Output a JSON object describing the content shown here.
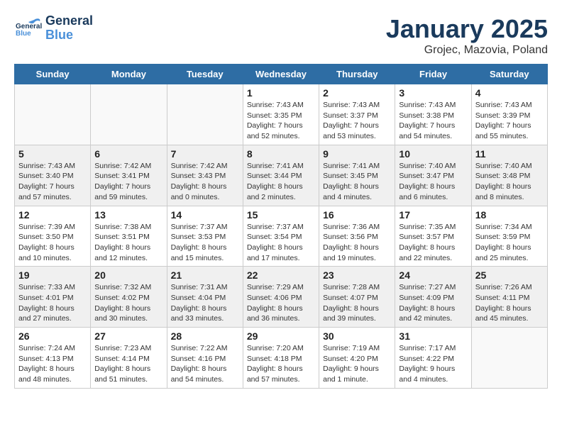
{
  "logo": {
    "line1": "General",
    "line2": "Blue"
  },
  "title": "January 2025",
  "location": "Grojec, Mazovia, Poland",
  "days_of_week": [
    "Sunday",
    "Monday",
    "Tuesday",
    "Wednesday",
    "Thursday",
    "Friday",
    "Saturday"
  ],
  "weeks": [
    [
      {
        "day": "",
        "info": ""
      },
      {
        "day": "",
        "info": ""
      },
      {
        "day": "",
        "info": ""
      },
      {
        "day": "1",
        "info": "Sunrise: 7:43 AM\nSunset: 3:35 PM\nDaylight: 7 hours\nand 52 minutes."
      },
      {
        "day": "2",
        "info": "Sunrise: 7:43 AM\nSunset: 3:37 PM\nDaylight: 7 hours\nand 53 minutes."
      },
      {
        "day": "3",
        "info": "Sunrise: 7:43 AM\nSunset: 3:38 PM\nDaylight: 7 hours\nand 54 minutes."
      },
      {
        "day": "4",
        "info": "Sunrise: 7:43 AM\nSunset: 3:39 PM\nDaylight: 7 hours\nand 55 minutes."
      }
    ],
    [
      {
        "day": "5",
        "info": "Sunrise: 7:43 AM\nSunset: 3:40 PM\nDaylight: 7 hours\nand 57 minutes."
      },
      {
        "day": "6",
        "info": "Sunrise: 7:42 AM\nSunset: 3:41 PM\nDaylight: 7 hours\nand 59 minutes."
      },
      {
        "day": "7",
        "info": "Sunrise: 7:42 AM\nSunset: 3:43 PM\nDaylight: 8 hours\nand 0 minutes."
      },
      {
        "day": "8",
        "info": "Sunrise: 7:41 AM\nSunset: 3:44 PM\nDaylight: 8 hours\nand 2 minutes."
      },
      {
        "day": "9",
        "info": "Sunrise: 7:41 AM\nSunset: 3:45 PM\nDaylight: 8 hours\nand 4 minutes."
      },
      {
        "day": "10",
        "info": "Sunrise: 7:40 AM\nSunset: 3:47 PM\nDaylight: 8 hours\nand 6 minutes."
      },
      {
        "day": "11",
        "info": "Sunrise: 7:40 AM\nSunset: 3:48 PM\nDaylight: 8 hours\nand 8 minutes."
      }
    ],
    [
      {
        "day": "12",
        "info": "Sunrise: 7:39 AM\nSunset: 3:50 PM\nDaylight: 8 hours\nand 10 minutes."
      },
      {
        "day": "13",
        "info": "Sunrise: 7:38 AM\nSunset: 3:51 PM\nDaylight: 8 hours\nand 12 minutes."
      },
      {
        "day": "14",
        "info": "Sunrise: 7:37 AM\nSunset: 3:53 PM\nDaylight: 8 hours\nand 15 minutes."
      },
      {
        "day": "15",
        "info": "Sunrise: 7:37 AM\nSunset: 3:54 PM\nDaylight: 8 hours\nand 17 minutes."
      },
      {
        "day": "16",
        "info": "Sunrise: 7:36 AM\nSunset: 3:56 PM\nDaylight: 8 hours\nand 19 minutes."
      },
      {
        "day": "17",
        "info": "Sunrise: 7:35 AM\nSunset: 3:57 PM\nDaylight: 8 hours\nand 22 minutes."
      },
      {
        "day": "18",
        "info": "Sunrise: 7:34 AM\nSunset: 3:59 PM\nDaylight: 8 hours\nand 25 minutes."
      }
    ],
    [
      {
        "day": "19",
        "info": "Sunrise: 7:33 AM\nSunset: 4:01 PM\nDaylight: 8 hours\nand 27 minutes."
      },
      {
        "day": "20",
        "info": "Sunrise: 7:32 AM\nSunset: 4:02 PM\nDaylight: 8 hours\nand 30 minutes."
      },
      {
        "day": "21",
        "info": "Sunrise: 7:31 AM\nSunset: 4:04 PM\nDaylight: 8 hours\nand 33 minutes."
      },
      {
        "day": "22",
        "info": "Sunrise: 7:29 AM\nSunset: 4:06 PM\nDaylight: 8 hours\nand 36 minutes."
      },
      {
        "day": "23",
        "info": "Sunrise: 7:28 AM\nSunset: 4:07 PM\nDaylight: 8 hours\nand 39 minutes."
      },
      {
        "day": "24",
        "info": "Sunrise: 7:27 AM\nSunset: 4:09 PM\nDaylight: 8 hours\nand 42 minutes."
      },
      {
        "day": "25",
        "info": "Sunrise: 7:26 AM\nSunset: 4:11 PM\nDaylight: 8 hours\nand 45 minutes."
      }
    ],
    [
      {
        "day": "26",
        "info": "Sunrise: 7:24 AM\nSunset: 4:13 PM\nDaylight: 8 hours\nand 48 minutes."
      },
      {
        "day": "27",
        "info": "Sunrise: 7:23 AM\nSunset: 4:14 PM\nDaylight: 8 hours\nand 51 minutes."
      },
      {
        "day": "28",
        "info": "Sunrise: 7:22 AM\nSunset: 4:16 PM\nDaylight: 8 hours\nand 54 minutes."
      },
      {
        "day": "29",
        "info": "Sunrise: 7:20 AM\nSunset: 4:18 PM\nDaylight: 8 hours\nand 57 minutes."
      },
      {
        "day": "30",
        "info": "Sunrise: 7:19 AM\nSunset: 4:20 PM\nDaylight: 9 hours\nand 1 minute."
      },
      {
        "day": "31",
        "info": "Sunrise: 7:17 AM\nSunset: 4:22 PM\nDaylight: 9 hours\nand 4 minutes."
      },
      {
        "day": "",
        "info": ""
      }
    ]
  ]
}
